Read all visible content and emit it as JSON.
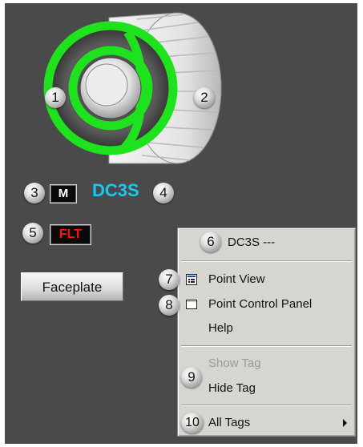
{
  "callouts": [
    "1",
    "2",
    "3",
    "4",
    "5",
    "6",
    "7",
    "8",
    "9",
    "10"
  ],
  "display": {
    "mode_badge": "M",
    "tag_name": "DC3S",
    "fault_badge": "FLT",
    "faceplate_label": "Faceplate",
    "colors": {
      "background": "#4a4a4a",
      "status_ring": "#1ee21e",
      "tag_text": "#19c8f0",
      "fault_text": "#ff1010"
    }
  },
  "context_menu": {
    "header": "DC3S ---",
    "items": [
      {
        "label": "Point View",
        "icon": "point-view-icon",
        "enabled": true
      },
      {
        "label": "Point Control Panel",
        "icon": "control-panel-icon",
        "enabled": true
      },
      {
        "label": "Help",
        "enabled": true
      },
      {
        "label": "Show Tag",
        "enabled": false
      },
      {
        "label": "Hide Tag",
        "enabled": true
      },
      {
        "label": "All Tags",
        "submenu": true,
        "enabled": true
      }
    ]
  }
}
